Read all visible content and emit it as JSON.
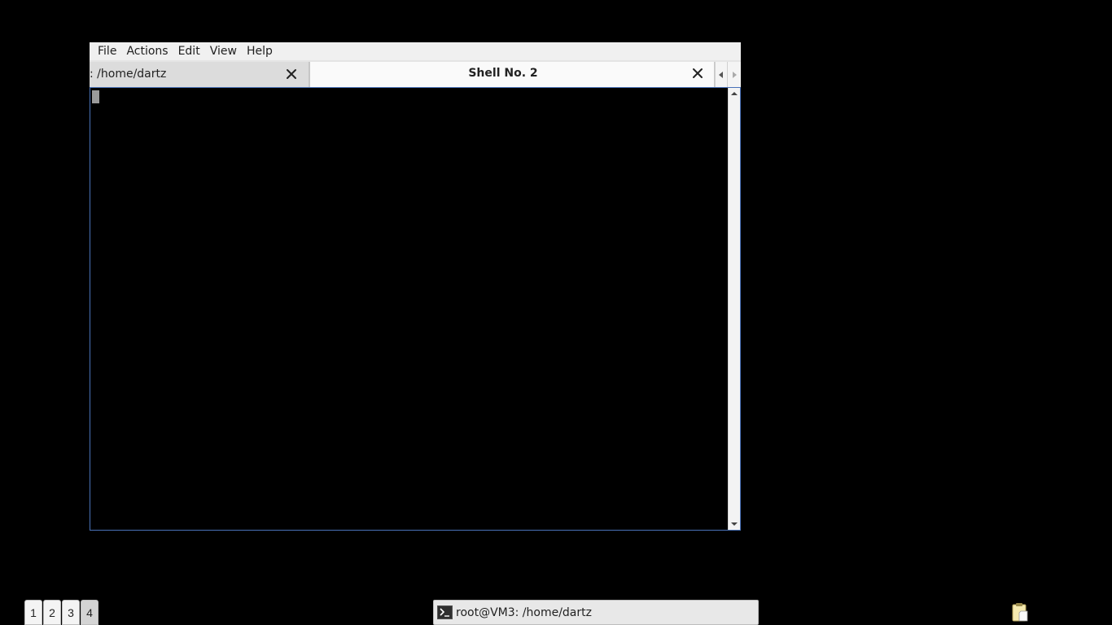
{
  "menubar": {
    "items": [
      "File",
      "Actions",
      "Edit",
      "View",
      "Help"
    ]
  },
  "tabs": [
    {
      "label": ": /home/dartz",
      "active": false
    },
    {
      "label": "Shell No. 2",
      "active": true
    }
  ],
  "icons": {
    "tab_close": "close-icon",
    "tab_scroll_left": "chevron-left-icon",
    "tab_scroll_right": "chevron-right-icon",
    "scroll_up": "arrow-up-icon",
    "scroll_down": "arrow-down-icon",
    "task": "terminal-icon",
    "tray": "clipboard-icon"
  },
  "taskbar": {
    "desktops": [
      "1",
      "2",
      "3",
      "4"
    ],
    "active_desktop": "4",
    "task_label": "root@VM3: /home/dartz"
  },
  "colors": {
    "desktop_bg": "#000000",
    "terminal_bg": "#000000",
    "focus_border": "#4a72b8"
  }
}
